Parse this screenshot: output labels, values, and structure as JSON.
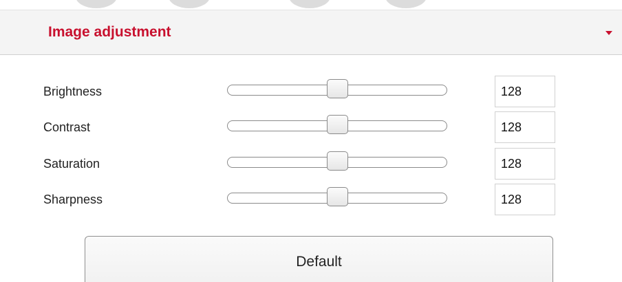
{
  "panel": {
    "title": "Image adjustment"
  },
  "adjustments": [
    {
      "label": "Brightness",
      "value": "128",
      "level": 0.5
    },
    {
      "label": "Contrast",
      "value": "128",
      "level": 0.5
    },
    {
      "label": "Saturation",
      "value": "128",
      "level": 0.5
    },
    {
      "label": "Sharpness",
      "value": "128",
      "level": 0.5
    }
  ],
  "buttons": {
    "default_label": "Default"
  },
  "colors": {
    "accent": "#c8102e",
    "header_bg": "#f4f4f4"
  },
  "icons": {
    "collapse": "caret-down-icon"
  }
}
